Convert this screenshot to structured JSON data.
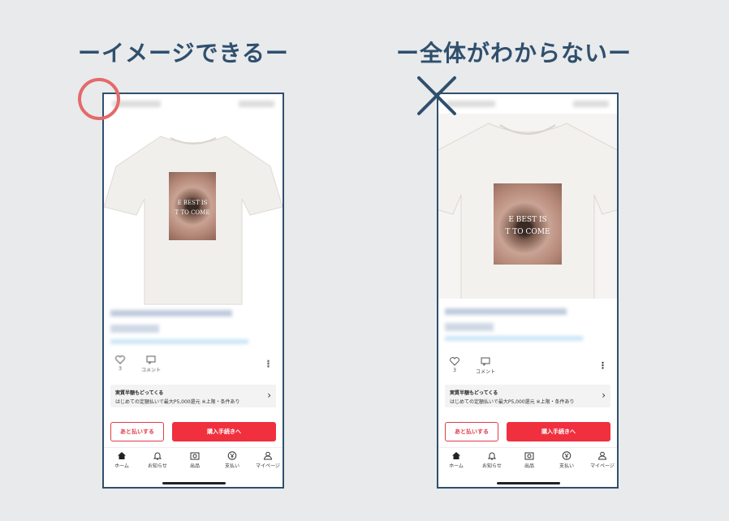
{
  "headings": {
    "left": "ーイメージできるー",
    "right": "ー全体がわからないー"
  },
  "markers": {
    "left": "circle",
    "right": "cross",
    "circle_color": "#e46a6a",
    "cross_color": "#2f4f6d"
  },
  "product": {
    "print_lines": [
      "E BEST IS",
      "T TO COME"
    ]
  },
  "actions": {
    "like_count": "3",
    "comment_label": "コメント",
    "more_icon": "more-vertical-icon"
  },
  "promo": {
    "title": "実質半額もどってくる",
    "subtitle": "はじめての定額払いで最大P5,000還元 ※上限・条件あり"
  },
  "buttons": {
    "pay_later": "あと払いする",
    "checkout": "購入手続きへ"
  },
  "tabs": [
    {
      "label": "ホーム",
      "icon": "home-icon"
    },
    {
      "label": "お知らせ",
      "icon": "bell-icon"
    },
    {
      "label": "出品",
      "icon": "camera-icon"
    },
    {
      "label": "支払い",
      "icon": "yen-icon"
    },
    {
      "label": "マイページ",
      "icon": "user-icon"
    }
  ],
  "colors": {
    "accent_red": "#f0303f",
    "frame": "#2f4f6d",
    "heading": "#2f4f6d"
  }
}
